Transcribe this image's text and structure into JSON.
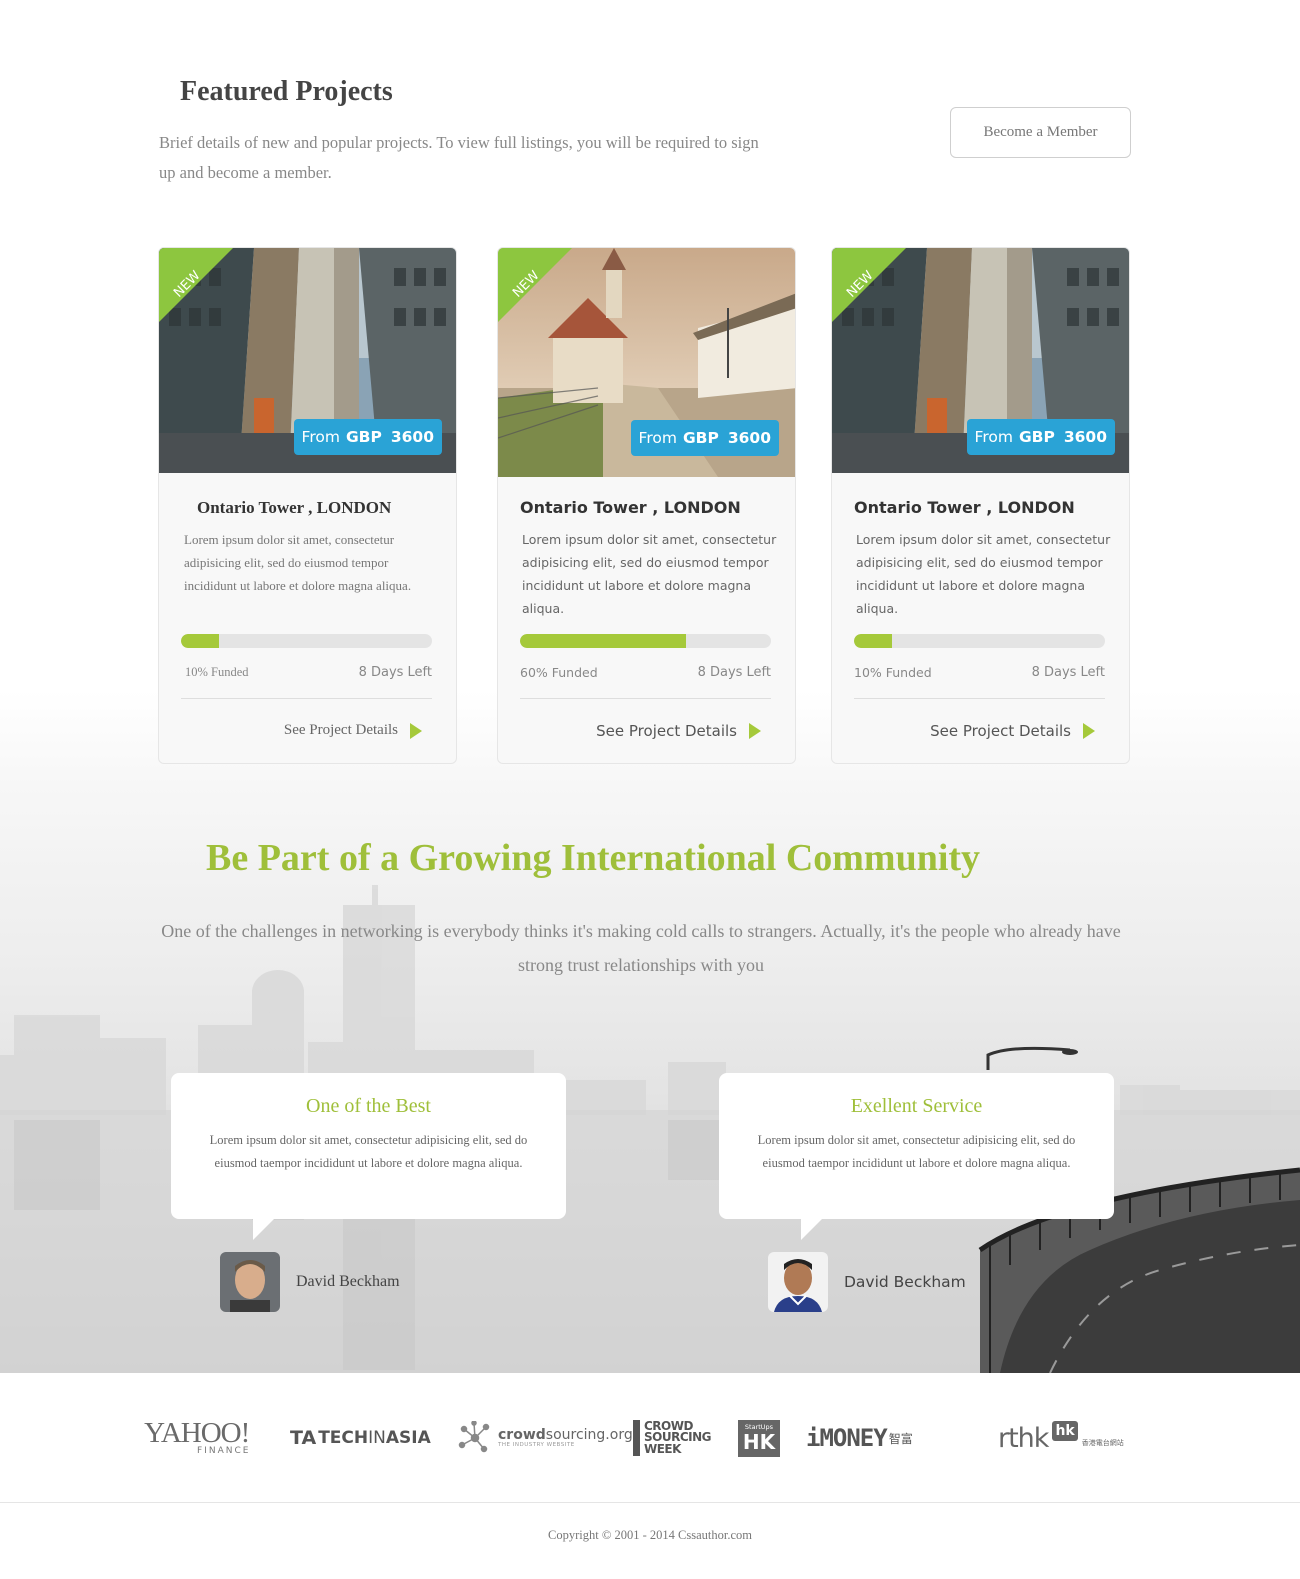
{
  "featured": {
    "title": "Featured Projects",
    "description": "Brief details of new and popular projects. To view full listings, you will be required to sign up and become a member.",
    "member_button": "Become a Member"
  },
  "projects": [
    {
      "badge": "NEW",
      "price_prefix": "From",
      "currency": "GBP",
      "amount": "3600",
      "title": "Ontario Tower , LONDON",
      "text": "Lorem ipsum dolor sit amet, consectetur adipisicing elit, sed do eiusmod tempor incididunt ut labore et dolore magna aliqua.",
      "funded_fraction": 0.15,
      "funded_label": "10% Funded",
      "days_left": "8 Days Left",
      "details_label": "See Project Details",
      "image": "city-street"
    },
    {
      "badge": "NEW",
      "price_prefix": "From",
      "currency": "GBP",
      "amount": "3600",
      "title": "Ontario Tower , LONDON",
      "text": "Lorem ipsum dolor sit amet, consectetur adipisicing elit, sed do eiusmod tempor incididunt ut labore et dolore magna aliqua.",
      "funded_fraction": 0.66,
      "funded_label": "60% Funded",
      "days_left": "8 Days Left",
      "details_label": "See Project Details",
      "image": "village-church"
    },
    {
      "badge": "NEW",
      "price_prefix": "From",
      "currency": "GBP",
      "amount": "3600",
      "title": "Ontario Tower , LONDON",
      "text": "Lorem ipsum dolor sit amet, consectetur adipisicing elit, sed do eiusmod tempor incididunt ut labore et dolore magna aliqua.",
      "funded_fraction": 0.15,
      "funded_label": "10% Funded",
      "days_left": "8 Days Left",
      "details_label": "See Project Details",
      "image": "city-street"
    }
  ],
  "community": {
    "title": "Be Part of a Growing International Community",
    "description": "One of the challenges in networking is everybody thinks it's making cold calls to strangers. Actually, it's the people who already have strong trust relationships with you"
  },
  "testimonials": [
    {
      "title": "One of the Best",
      "text": "Lorem ipsum dolor sit amet, consectetur adipisicing elit, sed do eiusmod taempor incididunt ut labore et dolore magna aliqua.",
      "name": "David Beckham"
    },
    {
      "title": "Exellent Service",
      "text": "Lorem ipsum dolor sit amet, consectetur adipisicing elit, sed do eiusmod taempor incididunt ut labore et dolore magna aliqua.",
      "name": "David Beckham"
    }
  ],
  "partners": {
    "yahoo": {
      "main": "YAHOO!",
      "sub": "FINANCE"
    },
    "techinasia": {
      "mark": "TA",
      "bold": "TECH",
      "thin": "IN",
      "tail": "ASIA"
    },
    "crowdsourcing_org": {
      "bold": "crowd",
      "rest": "sourcing.org",
      "tagline": "THE INDUSTRY WEBSITE"
    },
    "crowdsourcing_week": {
      "line1": "CROWD",
      "line2": "SOURCING",
      "line3": "WEEK"
    },
    "startups_hk": {
      "top": "StartUps",
      "main": "HK"
    },
    "imoney": {
      "latin": "iMONEY",
      "chinese": "智富"
    },
    "rthk": {
      "main": "rthk",
      "badge": "hk",
      "chinese": "香港電台網站"
    }
  },
  "footer": {
    "copyright": "Copyright © 2001 - 2014  Cssauthor.com"
  },
  "colors": {
    "accent_green": "#a5c93a",
    "price_blue": "#2aa3d6",
    "title_green": "#9fbf3a"
  }
}
